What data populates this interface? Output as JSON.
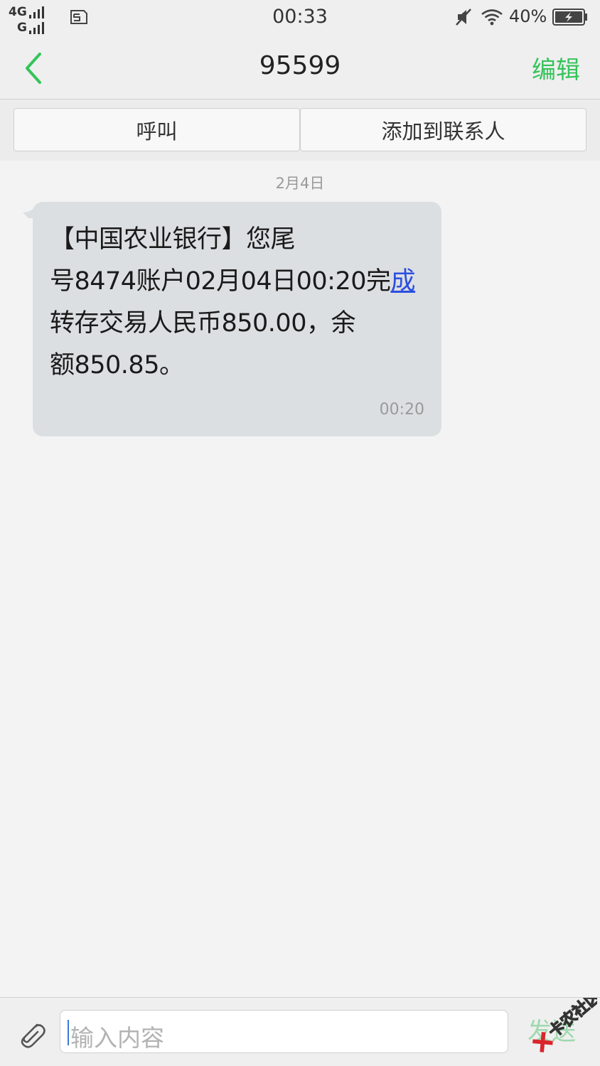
{
  "status_bar": {
    "network_labels": [
      "4G",
      "G"
    ],
    "time": "00:33",
    "battery_percent": "40%"
  },
  "header": {
    "title": "95599",
    "edit_label": "编辑"
  },
  "actions": {
    "call_label": "呼叫",
    "add_contact_label": "添加到联系人"
  },
  "conversation": {
    "date_separator": "2月4日",
    "messages": [
      {
        "lines": [
          "【中国农业银行】您尾",
          "号8474账户02月04日00:20完",
          "转存交易人民币850.00，余",
          "额850.85。"
        ],
        "line2_link": "成",
        "time": "00:20"
      }
    ]
  },
  "compose": {
    "placeholder": "输入内容",
    "send_label": "发送"
  },
  "watermark_text": "卡农社区",
  "colors": {
    "accent_green": "#34c45a",
    "bubble_bg": "#dcdfe1",
    "link_blue": "#2a4fe0"
  }
}
